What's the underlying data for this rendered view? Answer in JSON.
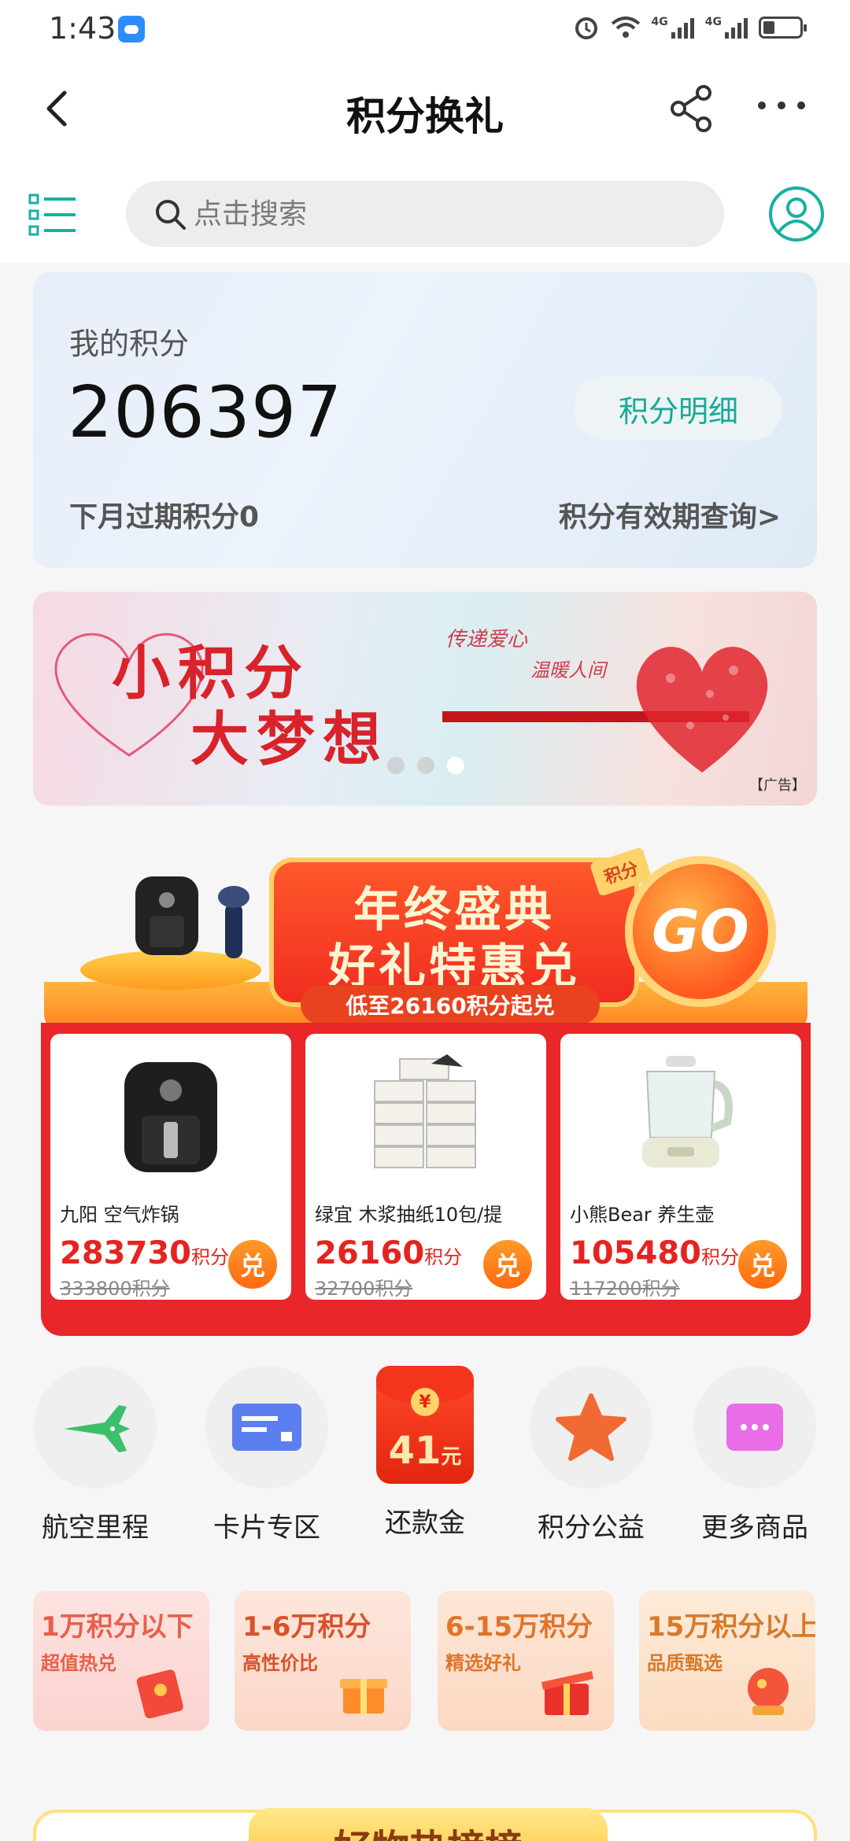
{
  "status_bar": {
    "time": "1:43",
    "network_labels": [
      "4G",
      "4G"
    ]
  },
  "header": {
    "title": "积分换礼"
  },
  "search": {
    "placeholder": "点击搜索"
  },
  "points": {
    "label": "我的积分",
    "value": "206397",
    "detail_button": "积分明细",
    "expire_text": "下月过期积分0",
    "validity_link": "积分有效期查询>"
  },
  "ad_banner": {
    "title_line1": "小积分",
    "title_line2": "大梦想",
    "sub_line1": "传递爱心",
    "sub_line2": "温暖人间",
    "ad_tag": "【广告】",
    "slide_count": 3,
    "active_slide": 3
  },
  "promo": {
    "title_line1": "年终盛典",
    "title_line2": "好礼特惠兑",
    "subtitle": "低至26160积分起兑",
    "go_label": "GO",
    "tag": "积分",
    "products": [
      {
        "name": "九阳 空气炸锅",
        "price": "283730",
        "unit": "积分",
        "original": "333800积分",
        "redeem": "兑"
      },
      {
        "name": "绿宜 木浆抽纸10包/提",
        "price": "26160",
        "unit": "积分",
        "original": "32700积分",
        "redeem": "兑"
      },
      {
        "name": "小熊Bear 养生壶",
        "price": "105480",
        "unit": "积分",
        "original": "117200积分",
        "redeem": "兑"
      }
    ]
  },
  "categories": [
    {
      "label": "航空里程",
      "icon": "airplane-icon"
    },
    {
      "label": "卡片专区",
      "icon": "card-icon"
    },
    {
      "label": "还款金",
      "icon": "red-packet-icon",
      "badge_symbol": "¥",
      "badge_amount": "41",
      "badge_unit": "元"
    },
    {
      "label": "积分公益",
      "icon": "star-icon"
    },
    {
      "label": "更多商品",
      "icon": "more-icon"
    }
  ],
  "ranges": [
    {
      "title": "1万积分以下",
      "sub": "超值热兑",
      "color": "#e8604a",
      "bg": "#fde3e0"
    },
    {
      "title": "1-6万积分",
      "sub": "高性价比",
      "color": "#d9532a",
      "bg": "#fde6dc"
    },
    {
      "title": "6-15万积分",
      "sub": "精选好礼",
      "color": "#e0742a",
      "bg": "#fde6d6"
    },
    {
      "title": "15万积分以上",
      "sub": "品质甄选",
      "color": "#d77a2a",
      "bg": "#fdebd8"
    }
  ],
  "hotlist": {
    "title": "好物热榜榜"
  },
  "colors": {
    "accent": "#18a99a",
    "promo_red": "#e9262a",
    "price_red": "#e5231f"
  }
}
